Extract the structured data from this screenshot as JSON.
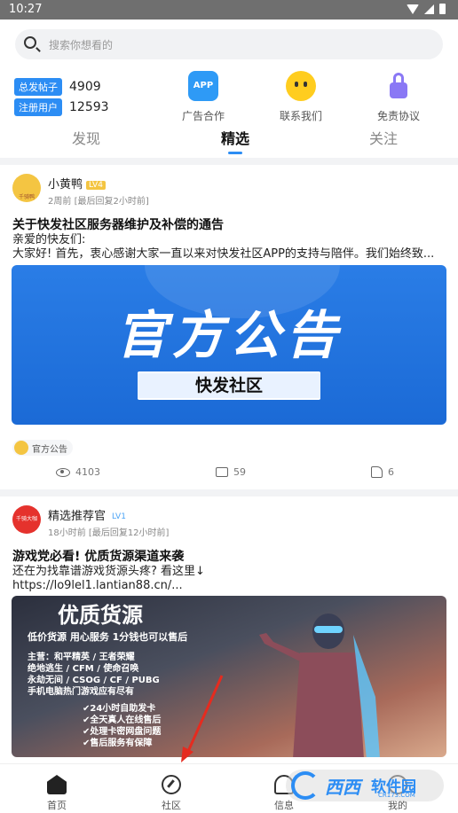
{
  "status_bar": {
    "time": "10:27"
  },
  "search": {
    "placeholder": "搜索你想看的"
  },
  "stats": [
    {
      "label": "总发帖子",
      "value": "4909"
    },
    {
      "label": "注册用户",
      "value": "12593"
    }
  ],
  "quick_links": [
    {
      "label": "广告合作",
      "icon": "app-icon",
      "icon_text": "APP"
    },
    {
      "label": "联系我们",
      "icon": "robot-icon"
    },
    {
      "label": "免责协议",
      "icon": "lock-icon"
    }
  ],
  "tabs": [
    {
      "label": "发现",
      "active": false
    },
    {
      "label": "精选",
      "active": true
    },
    {
      "label": "关注",
      "active": false
    }
  ],
  "posts": [
    {
      "author": "小黄鸭",
      "level": "LV4",
      "avatar_text": "千骑鸭",
      "time": "2周前",
      "last_reply": "[最后回复2小时前]",
      "title": "关于快发社区服务器维护及补偿的通告",
      "lines": [
        "亲爱的快友们:",
        "大家好! 首先，衷心感谢大家一直以来对快发社区APP的支持与陪伴。我们始终致..."
      ],
      "banner": {
        "headline": "官方公告",
        "subtitle": "快发社区"
      },
      "tag": "官方公告",
      "views": "4103",
      "comments": "59",
      "likes": "6"
    },
    {
      "author": "精选推荐官",
      "level": "LV1",
      "avatar_text": "千骑大咖",
      "time": "18小时前",
      "last_reply": "[最后回复12小时前]",
      "title": "游戏党必看! 优质货源渠道来袭",
      "lines": [
        "还在为找靠谱游戏货源头疼? 看这里↓",
        "https://lo9lel1.lantian88.cn/..."
      ],
      "banner": {
        "headline": "优质货源",
        "slogan": "低价货源 用心服务 1分钱也可以售后",
        "games": [
          "主营：和平精英 / 王者荣耀",
          "绝地逃生 / CFM / 使命召唤",
          "永劫无间 / CSOG / CF / PUBG",
          "手机电脑热门游戏应有尽有"
        ],
        "features": [
          "✔24小时自助发卡",
          "✔全天真人在线售后",
          "✔处理卡密网盘问题",
          "✔售后服务有保障"
        ]
      }
    }
  ],
  "bottom_nav": [
    {
      "label": "首页",
      "icon": "home-icon"
    },
    {
      "label": "社区",
      "icon": "compass-icon"
    },
    {
      "label": "信息",
      "icon": "message-icon"
    },
    {
      "label": "我的",
      "icon": "profile-icon"
    }
  ],
  "watermark": {
    "brand": "西西",
    "name": "软件园",
    "domain": "CR173.COM"
  },
  "colors": {
    "accent": "#2c8df4",
    "status_bar": "#6f6f6f",
    "separator": "#f2f3f5"
  }
}
